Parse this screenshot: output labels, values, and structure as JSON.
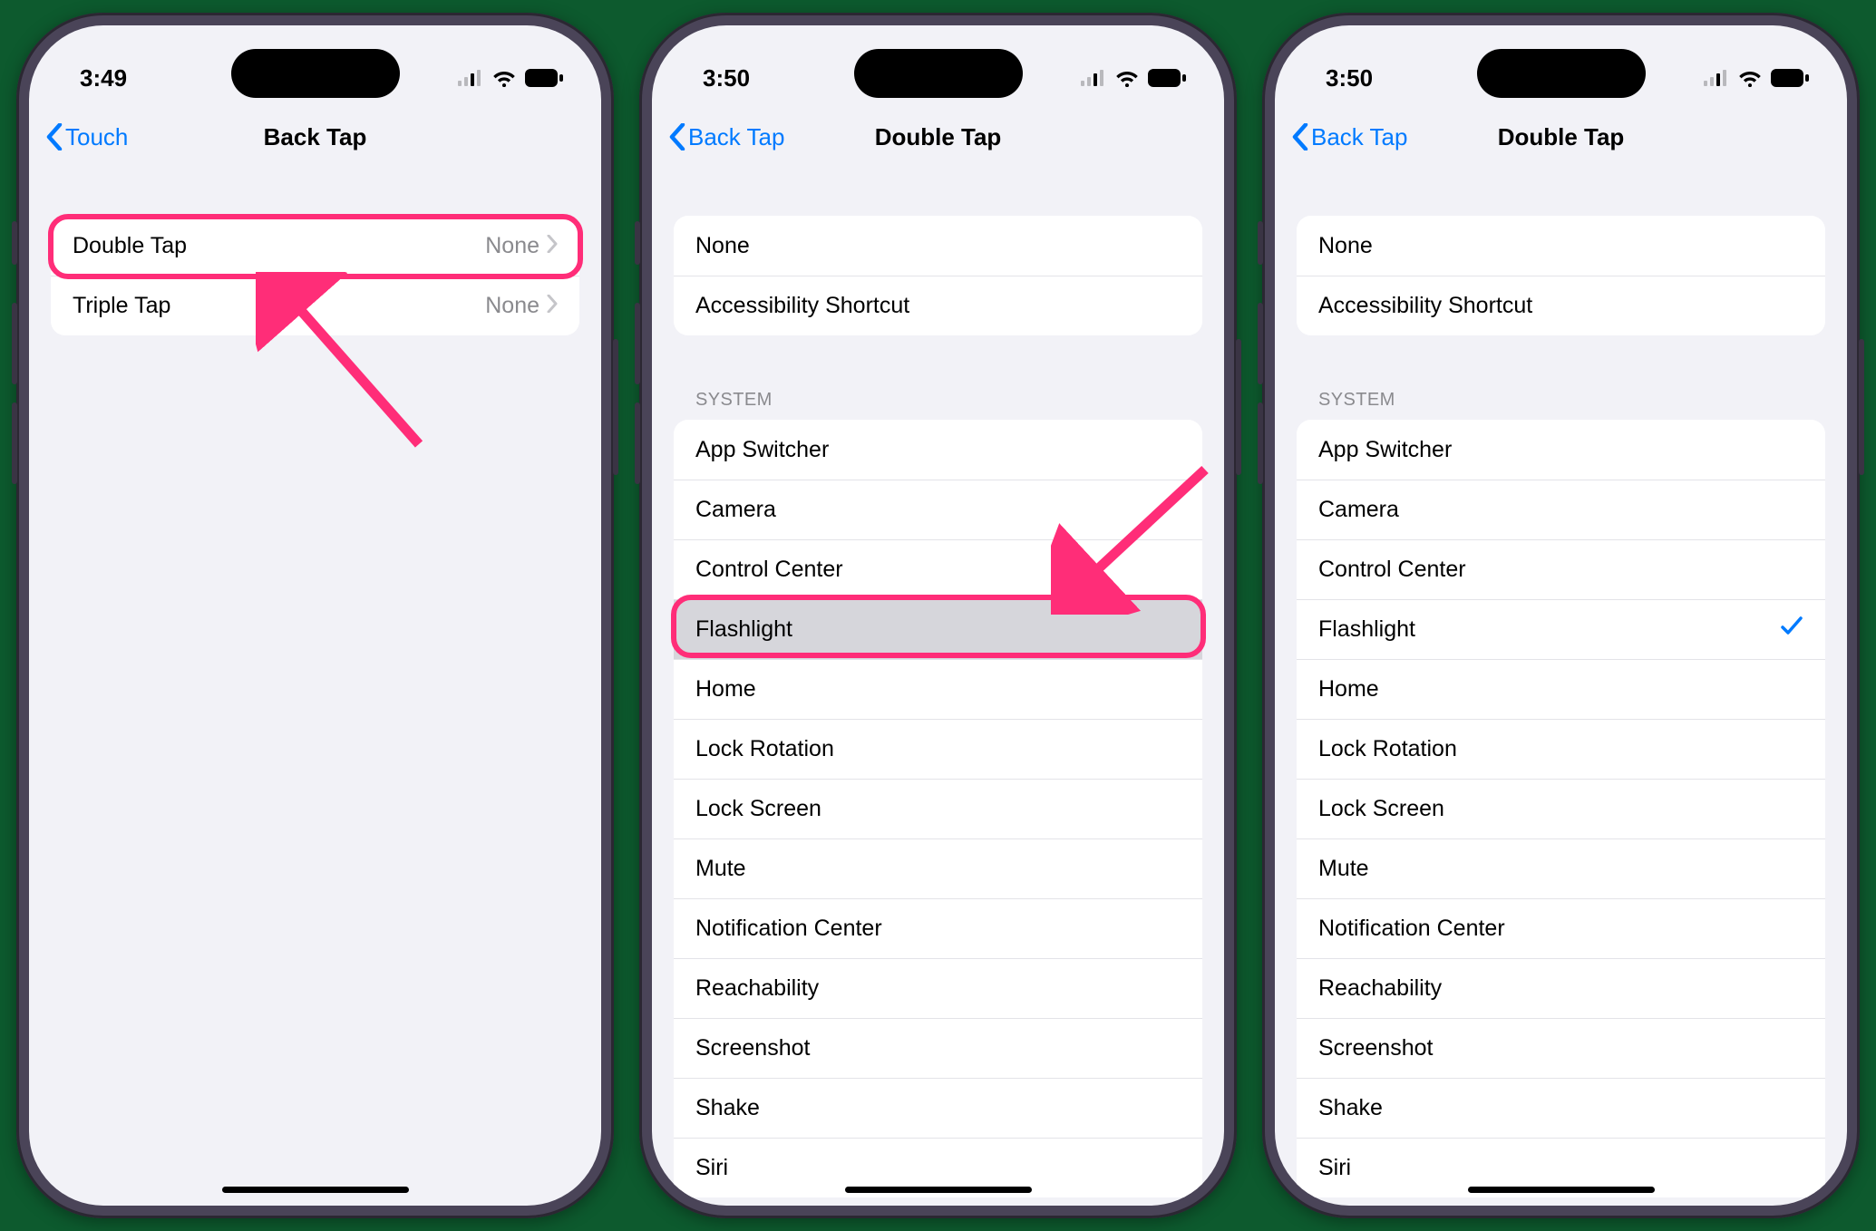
{
  "colors": {
    "ios_blue": "#007aff",
    "callout_pink": "#ff2d78",
    "bg": "#f2f2f7"
  },
  "screens": [
    {
      "id": "s1",
      "status_time": "3:49",
      "nav_back_label": "Touch",
      "nav_title": "Back Tap",
      "top_group": [
        {
          "label": "Double Tap",
          "value": "None",
          "has_callout": true
        },
        {
          "label": "Triple Tap",
          "value": "None",
          "has_callout": false
        }
      ]
    },
    {
      "id": "s2",
      "status_time": "3:50",
      "nav_back_label": "Back Tap",
      "nav_title": "Double Tap",
      "top_group": [
        {
          "label": "None"
        },
        {
          "label": "Accessibility Shortcut"
        }
      ],
      "section_header": "SYSTEM",
      "system_group": [
        {
          "label": "App Switcher"
        },
        {
          "label": "Camera"
        },
        {
          "label": "Control Center"
        },
        {
          "label": "Flashlight",
          "pressed": true,
          "has_callout": true
        },
        {
          "label": "Home"
        },
        {
          "label": "Lock Rotation"
        },
        {
          "label": "Lock Screen"
        },
        {
          "label": "Mute"
        },
        {
          "label": "Notification Center"
        },
        {
          "label": "Reachability"
        },
        {
          "label": "Screenshot"
        },
        {
          "label": "Shake"
        },
        {
          "label": "Siri"
        }
      ]
    },
    {
      "id": "s3",
      "status_time": "3:50",
      "nav_back_label": "Back Tap",
      "nav_title": "Double Tap",
      "top_group": [
        {
          "label": "None"
        },
        {
          "label": "Accessibility Shortcut"
        }
      ],
      "section_header": "SYSTEM",
      "system_group": [
        {
          "label": "App Switcher"
        },
        {
          "label": "Camera"
        },
        {
          "label": "Control Center"
        },
        {
          "label": "Flashlight",
          "checked": true
        },
        {
          "label": "Home"
        },
        {
          "label": "Lock Rotation"
        },
        {
          "label": "Lock Screen"
        },
        {
          "label": "Mute"
        },
        {
          "label": "Notification Center"
        },
        {
          "label": "Reachability"
        },
        {
          "label": "Screenshot"
        },
        {
          "label": "Shake"
        },
        {
          "label": "Siri"
        }
      ]
    }
  ]
}
